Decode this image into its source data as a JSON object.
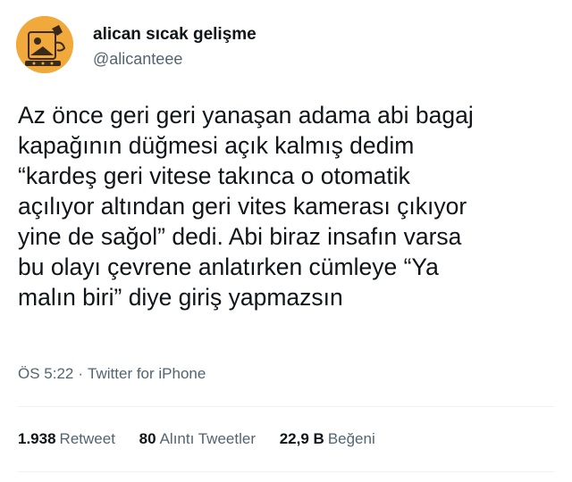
{
  "author": {
    "display_name": "alican sıcak gelişme",
    "handle": "@alicanteee",
    "avatar_icon": "illustrated-avatar-icon"
  },
  "tweet": {
    "lines": [
      "Az önce geri geri yanaşan adama abi bagaj",
      "kapağının düğmesi açık kalmış dedim",
      "“kardeş geri vitese takınca o otomatik",
      "açılıyor altından geri vites kamerası çıkıyor",
      "yine de sağol” dedi. Abi biraz insafın varsa",
      "bu olayı çevrene anlatırken cümleye “Ya",
      "malın biri” diye giriş yapmazsın"
    ]
  },
  "meta": {
    "time": "ÖS 5:22",
    "separator": "·",
    "source": "Twitter for iPhone"
  },
  "stats": {
    "retweets": {
      "count": "1.938",
      "label": "Retweet"
    },
    "quotes": {
      "count": "80",
      "label": "Alıntı Tweetler"
    },
    "likes": {
      "count": "22,9 B",
      "label": "Beğeni"
    }
  },
  "colors": {
    "text": "#0f1419",
    "secondary": "#536471",
    "divider": "#eff3f4",
    "avatar_bg": "#f2a93b"
  }
}
